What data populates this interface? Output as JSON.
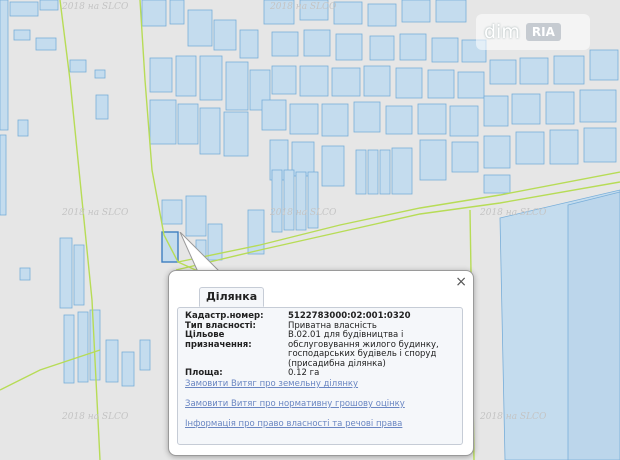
{
  "watermark": "2018 на SLCO",
  "logo": {
    "primary": "dim",
    "secondary": "RIA"
  },
  "popup": {
    "close_glyph": "×",
    "tab_title": "Ділянка",
    "fields": [
      {
        "label": "Кадастр.номер:",
        "value": "5122783000:02:001:0320",
        "bold": true
      },
      {
        "label": "Тип власності:",
        "value": "Приватна власність"
      },
      {
        "label": "Цільове призначення:",
        "value": "В.02.01 для будівництва і обслуговування жилого будинку, господарських будівель і споруд (присадибна ділянка)"
      },
      {
        "label": "Площа:",
        "value": "0.12 га"
      }
    ],
    "links": [
      "Замовити Витяг про земельну ділянку",
      "Замовити Витяг про нормативну грошову оцінку",
      "Інформація про право власності та речові права"
    ]
  },
  "colors": {
    "map_background": "#e6e6e6",
    "road": "#b7dc56",
    "parcel_fill": "#c4dcee",
    "parcel_stroke": "#78aed9",
    "link": "#6a86c2"
  }
}
